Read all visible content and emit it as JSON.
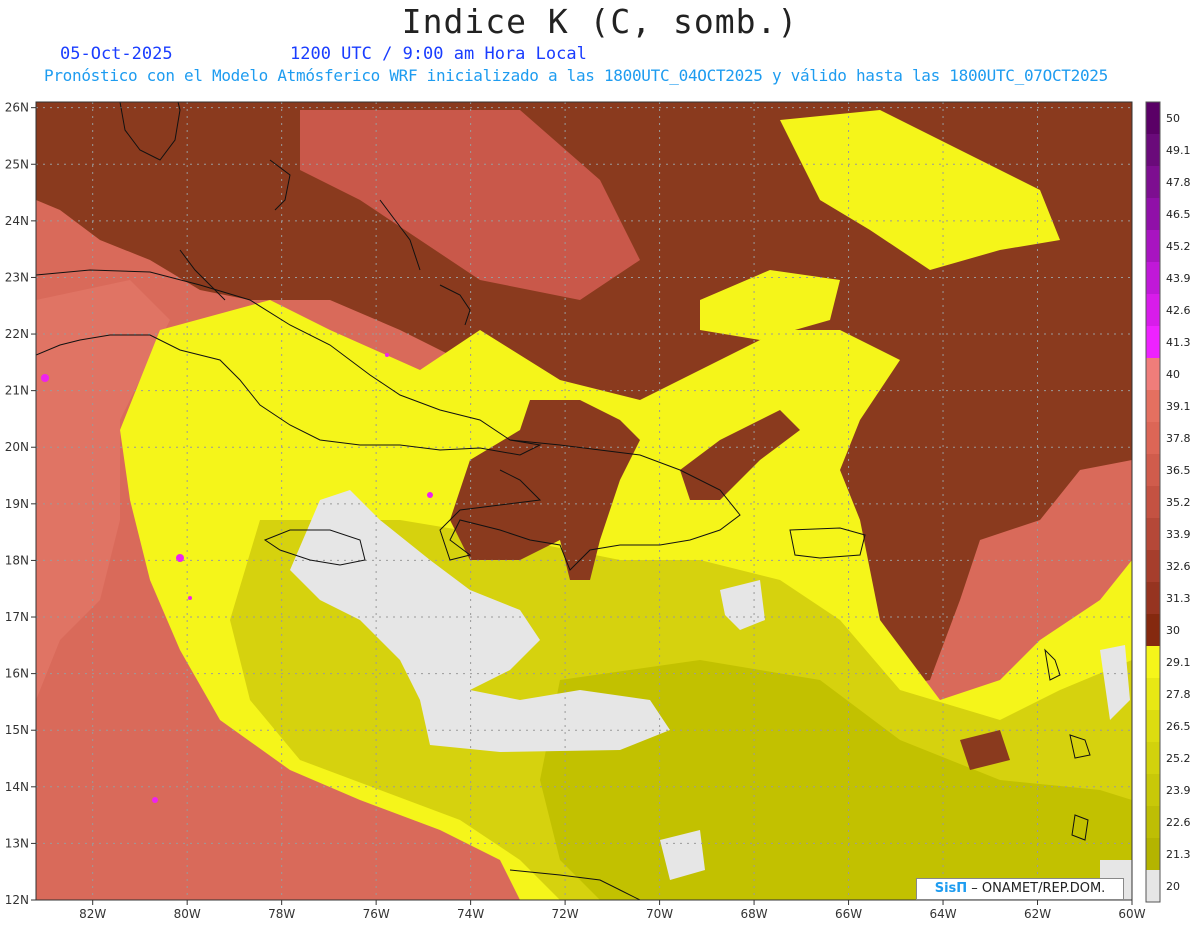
{
  "header": {
    "title": "Indice K (C, somb.)",
    "date": "05-Oct-2025",
    "time": "1200 UTC / 9:00 am Hora Local",
    "forecast": "Pronóstico con el Modelo Atmósferico WRF inicializado a las 1800UTC_04OCT2025 y válido hasta las  1800UTC_07OCT2025"
  },
  "map": {
    "lon_ticks": [
      "82W",
      "80W",
      "78W",
      "76W",
      "74W",
      "72W",
      "70W",
      "68W",
      "66W",
      "64W",
      "62W",
      "60W"
    ],
    "lat_ticks": [
      "26N",
      "25N",
      "24N",
      "23N",
      "22N",
      "21N",
      "20N",
      "19N",
      "18N",
      "17N",
      "16N",
      "15N",
      "14N",
      "13N",
      "12N"
    ],
    "lon_range": [
      -83.2,
      -60
    ],
    "lat_range": [
      12,
      26.1
    ],
    "colors": {
      "gray": "#e6e6e6",
      "olive_low": "#c2c100",
      "yellow": "#f5f51a",
      "dark_brown": "#8a3a1e",
      "salmon": "#d96a5a",
      "magenta": "#ee22ee",
      "purple": "#6a0a7a"
    }
  },
  "colorbar": {
    "labels": [
      "50",
      "49.1",
      "47.8",
      "46.5",
      "45.2",
      "43.9",
      "42.6",
      "41.3",
      "40",
      "39.1",
      "37.8",
      "36.5",
      "35.2",
      "33.9",
      "32.6",
      "31.3",
      "30",
      "29.1",
      "27.8",
      "26.5",
      "25.2",
      "23.9",
      "22.6",
      "21.3",
      "20"
    ],
    "colors": [
      "#5a0066",
      "#6a0a7a",
      "#7d0e90",
      "#9010a8",
      "#a814c0",
      "#c018d8",
      "#d81cea",
      "#ee22ff",
      "#f07d7a",
      "#e47060",
      "#dc6656",
      "#d05c4c",
      "#c45242",
      "#b54838",
      "#a63e2c",
      "#963420",
      "#85290f",
      "#f5f51a",
      "#e8e814",
      "#dcdc10",
      "#d2d20c",
      "#c8c808",
      "#bebe04",
      "#b4b400",
      "#e6e6e6"
    ]
  },
  "credit": {
    "brand": "SisΠ",
    "text": " – ONAMET/REP.DOM."
  }
}
